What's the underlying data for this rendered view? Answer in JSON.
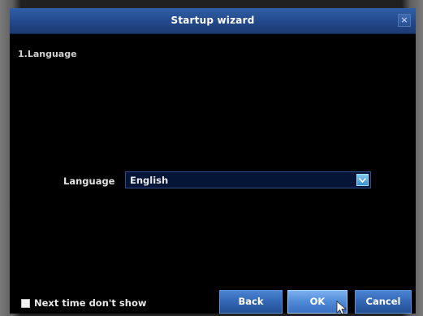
{
  "window": {
    "title": "Startup wizard",
    "close_label": "×"
  },
  "section": {
    "title": "1.Language"
  },
  "language": {
    "label": "Language",
    "selected": "English"
  },
  "footer": {
    "checkbox_label": "Next time don't show",
    "checked": false,
    "back_label": "Back",
    "ok_label": "OK",
    "cancel_label": "Cancel"
  },
  "colors": {
    "titlebar": "#23498a",
    "button": "#3366b4",
    "button_focused": "#4f8ad8",
    "background": "#000000"
  },
  "icons": [
    "close-icon",
    "chevron-down-icon",
    "mouse-cursor-icon"
  ]
}
